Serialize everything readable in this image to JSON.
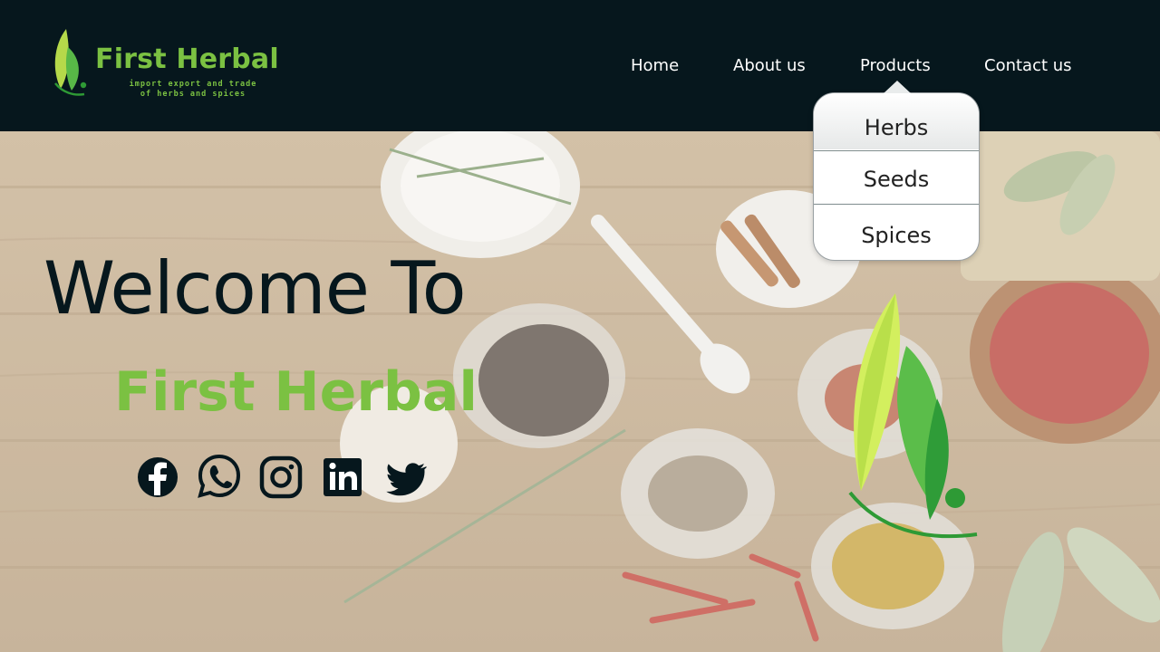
{
  "header": {
    "logo_title": "First Herbal",
    "logo_tagline_line1": "import export and trade",
    "logo_tagline_line2": "of herbs and spices"
  },
  "nav": {
    "home": "Home",
    "about": "About us",
    "products": "Products",
    "contact": "Contact us"
  },
  "products_menu": [
    "Herbs",
    "Seeds",
    "Spices"
  ],
  "hero": {
    "welcome": "Welcome To",
    "brand": "First Herbal"
  },
  "social_icons": [
    "facebook-icon",
    "whatsapp-icon",
    "instagram-icon",
    "linkedin-icon",
    "twitter-icon"
  ],
  "colors": {
    "nav_bg": "#06171d",
    "brand_green": "#7bc142",
    "light_green": "#c8e04a",
    "dark_green": "#2e9a35"
  }
}
